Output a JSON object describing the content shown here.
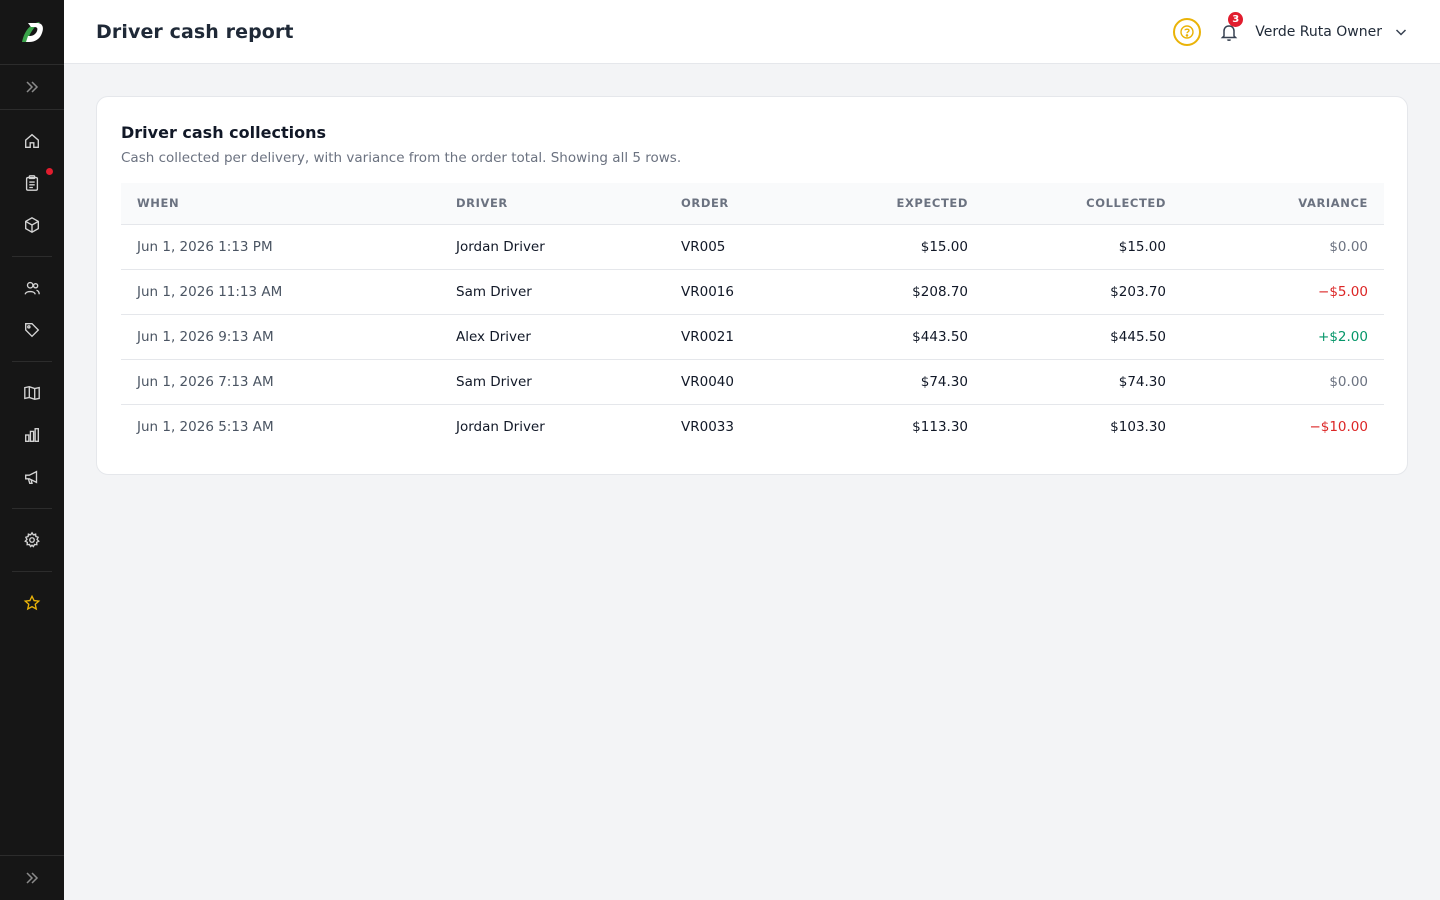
{
  "app": {
    "logo_letter": "D"
  },
  "header": {
    "title": "Driver cash report",
    "notification_count": "3",
    "user_name": "Verde Ruta Owner"
  },
  "sidebar": {
    "items": [
      {
        "name": "home",
        "icon": "home-icon"
      },
      {
        "name": "orders",
        "icon": "clipboard-icon",
        "has_dot": true
      },
      {
        "name": "products",
        "icon": "box-icon"
      },
      {
        "name": "customers",
        "icon": "users-icon"
      },
      {
        "name": "tags",
        "icon": "tag-icon"
      },
      {
        "name": "catalog",
        "icon": "book-icon"
      },
      {
        "name": "reports",
        "icon": "bar-chart-icon"
      },
      {
        "name": "marketing",
        "icon": "megaphone-icon"
      },
      {
        "name": "settings",
        "icon": "gear-icon"
      },
      {
        "name": "favorites",
        "icon": "star-icon"
      }
    ],
    "accent_dot_color": "#e11d2e",
    "star_color": "#eab308"
  },
  "card": {
    "title": "Driver cash collections",
    "subtitle": "Cash collected per delivery, with variance from the order total. Showing all 5 rows."
  },
  "table": {
    "columns": [
      "WHEN",
      "DRIVER",
      "ORDER",
      "EXPECTED",
      "COLLECTED",
      "VARIANCE"
    ],
    "rows": [
      {
        "when": "Jun 1, 2026 1:13 PM",
        "driver": "Jordan Driver",
        "order": "VR005",
        "expected": "$15.00",
        "collected": "$15.00",
        "variance": "$0.00",
        "variance_kind": "zero"
      },
      {
        "when": "Jun 1, 2026 11:13 AM",
        "driver": "Sam Driver",
        "order": "VR0016",
        "expected": "$208.70",
        "collected": "$203.70",
        "variance": "−$5.00",
        "variance_kind": "neg"
      },
      {
        "when": "Jun 1, 2026 9:13 AM",
        "driver": "Alex Driver",
        "order": "VR0021",
        "expected": "$443.50",
        "collected": "$445.50",
        "variance": "+$2.00",
        "variance_kind": "pos"
      },
      {
        "when": "Jun 1, 2026 7:13 AM",
        "driver": "Sam Driver",
        "order": "VR0040",
        "expected": "$74.30",
        "collected": "$74.30",
        "variance": "$0.00",
        "variance_kind": "zero"
      },
      {
        "when": "Jun 1, 2026 5:13 AM",
        "driver": "Jordan Driver",
        "order": "VR0033",
        "expected": "$113.30",
        "collected": "$103.30",
        "variance": "−$10.00",
        "variance_kind": "neg"
      }
    ]
  },
  "colors": {
    "negative": "#dc2626",
    "positive": "#059669",
    "neutral": "#6b7280"
  }
}
